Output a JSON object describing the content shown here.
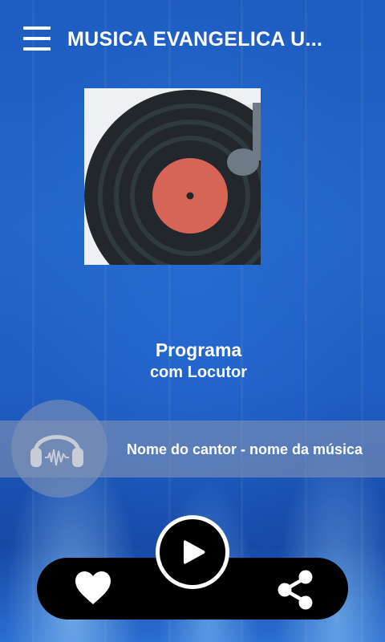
{
  "header": {
    "title": "MUSICA EVANGELICA U..."
  },
  "program": {
    "name": "Programa",
    "host": "com Locutor"
  },
  "now_playing": {
    "track": "Nome do cantor - nome da música"
  },
  "icons": {
    "menu": "hamburger-menu-icon",
    "cover": "vinyl-record-music-note-icon",
    "headphones": "headphones-icon",
    "play": "play-icon",
    "like": "heart-icon",
    "share": "share-icon"
  },
  "colors": {
    "background": "#1f5ec4",
    "record": "#22272b",
    "record_label": "#d76556",
    "note": "#6e7b87",
    "controls": "#000000",
    "now_bar": "#8092b4"
  }
}
